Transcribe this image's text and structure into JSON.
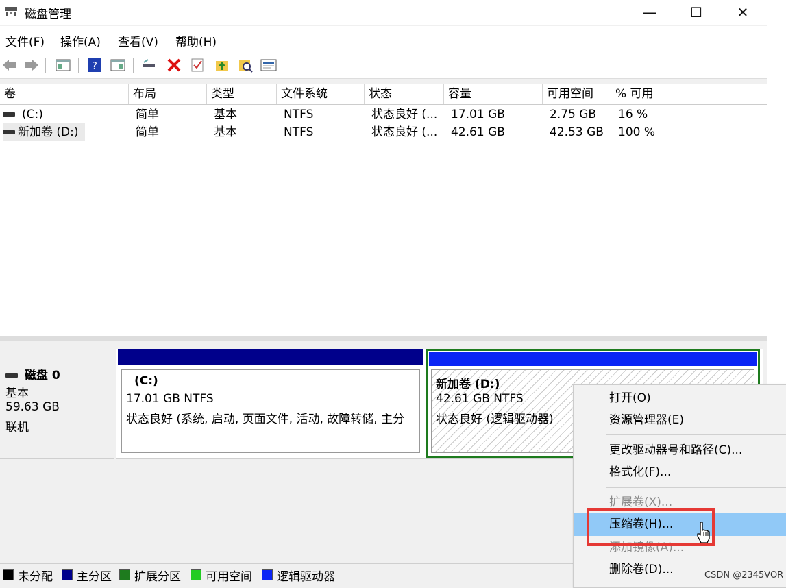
{
  "window": {
    "title": "磁盘管理",
    "min_icon": "—",
    "max_icon": "☐",
    "close_icon": "✕"
  },
  "menubar": {
    "file": "文件(F)",
    "action": "操作(A)",
    "view": "查看(V)",
    "help": "帮助(H)"
  },
  "toolbar": {
    "icons": [
      "back-icon",
      "forward-icon",
      "console-tree-icon",
      "help-icon",
      "show-pane-icon",
      "connect-icon",
      "delete-icon",
      "check-icon",
      "up-icon",
      "search-icon",
      "properties-icon"
    ]
  },
  "list": {
    "headers": [
      "卷",
      "布局",
      "类型",
      "文件系统",
      "状态",
      "容量",
      "可用空间",
      "% 可用"
    ],
    "rows": [
      {
        "volume": "(C:)",
        "layout": "简单",
        "type": "基本",
        "fs": "NTFS",
        "status": "状态良好 (...",
        "capacity": "17.01 GB",
        "free": "2.75 GB",
        "pct": "16 %"
      },
      {
        "volume": "新加卷 (D:)",
        "layout": "简单",
        "type": "基本",
        "fs": "NTFS",
        "status": "状态良好 (...",
        "capacity": "42.61 GB",
        "free": "42.53 GB",
        "pct": "100 %"
      }
    ]
  },
  "disk": {
    "name": "磁盘 0",
    "type": "基本",
    "size": "59.63 GB",
    "state": "联机",
    "partitions": [
      {
        "title": "(C:)",
        "size_fs": "17.01 GB NTFS",
        "status": "状态良好 (系统, 启动, 页面文件, 活动, 故障转储, 主分",
        "bar_color": "#00008b"
      },
      {
        "title": "新加卷  (D:)",
        "size_fs": "42.61 GB NTFS",
        "status": "状态良好 (逻辑驱动器)",
        "bar_color": "#0a24f5"
      }
    ]
  },
  "legend": [
    {
      "label": "未分配",
      "color": "#000000"
    },
    {
      "label": "主分区",
      "color": "#00008b"
    },
    {
      "label": "扩展分区",
      "color": "#1e7b1e"
    },
    {
      "label": "可用空间",
      "color": "#22cc22"
    },
    {
      "label": "逻辑驱动器",
      "color": "#0a24f5"
    }
  ],
  "context_menu": {
    "open": "打开(O)",
    "explorer": "资源管理器(E)",
    "change_letter": "更改驱动器号和路径(C)...",
    "format": "格式化(F)...",
    "extend": "扩展卷(X)...",
    "shrink": "压缩卷(H)...",
    "add_mirror": "添加镜像(A)...",
    "delete": "删除卷(D)..."
  },
  "watermark": "CSDN @2345VOR"
}
